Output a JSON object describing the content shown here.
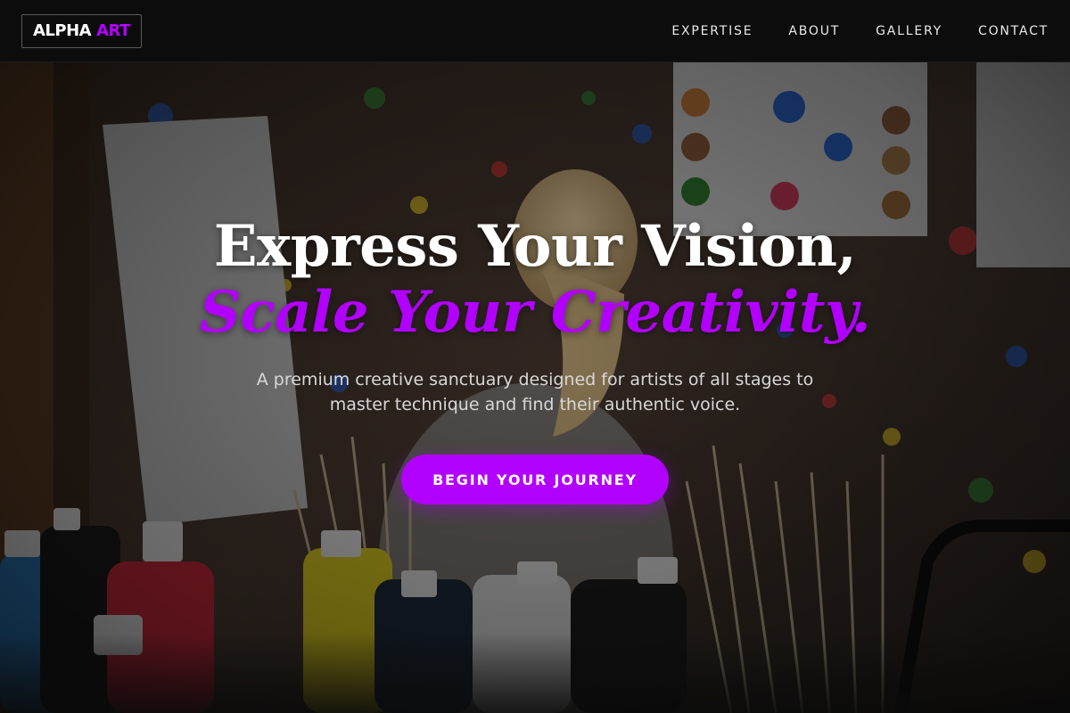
{
  "brand": {
    "name_part1": "ALPHA",
    "name_part2": "ART",
    "accent_color": "#b200ff"
  },
  "nav": {
    "items": [
      {
        "label": "EXPERTISE"
      },
      {
        "label": "ABOUT"
      },
      {
        "label": "GALLERY"
      },
      {
        "label": "CONTACT"
      }
    ]
  },
  "hero": {
    "headline_line1": "Express Your Vision,",
    "headline_line2": "Scale Your Creativity.",
    "subtitle": "A premium creative sanctuary designed for artists of all stages to master technique and find their authentic voice.",
    "cta_label": "BEGIN YOUR JOURNEY",
    "background_image": "art studio with paint-splattered walls, paint bottles, brushes and a blonde artist"
  }
}
